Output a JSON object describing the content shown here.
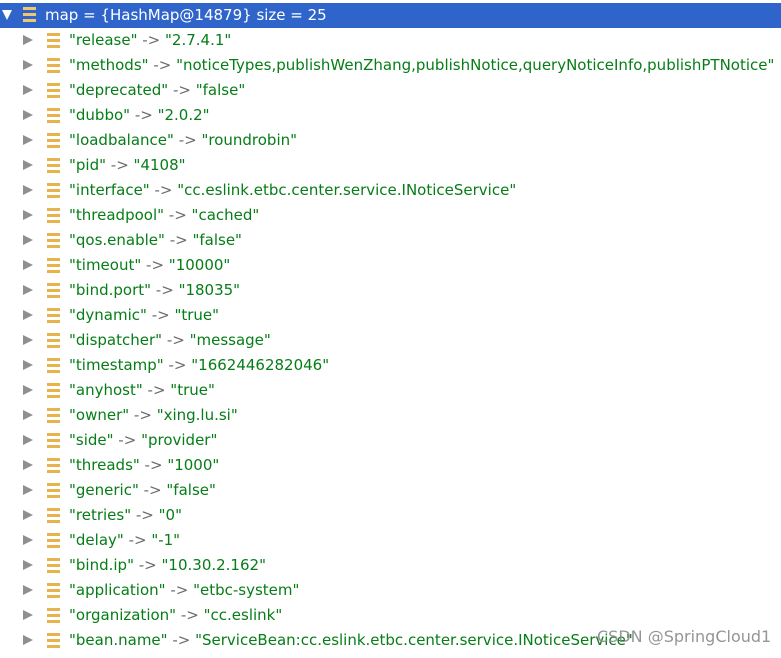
{
  "root": {
    "label": "map = {HashMap@14879}  size = 25"
  },
  "separator": " -> ",
  "entries": [
    {
      "key": "\"release\"",
      "value": "\"2.7.4.1\""
    },
    {
      "key": "\"methods\"",
      "value": "\"noticeTypes,publishWenZhang,publishNotice,queryNoticeInfo,publishPTNotice\""
    },
    {
      "key": "\"deprecated\"",
      "value": "\"false\""
    },
    {
      "key": "\"dubbo\"",
      "value": "\"2.0.2\""
    },
    {
      "key": "\"loadbalance\"",
      "value": "\"roundrobin\""
    },
    {
      "key": "\"pid\"",
      "value": "\"4108\""
    },
    {
      "key": "\"interface\"",
      "value": "\"cc.eslink.etbc.center.service.INoticeService\""
    },
    {
      "key": "\"threadpool\"",
      "value": "\"cached\""
    },
    {
      "key": "\"qos.enable\"",
      "value": "\"false\""
    },
    {
      "key": "\"timeout\"",
      "value": "\"10000\""
    },
    {
      "key": "\"bind.port\"",
      "value": "\"18035\""
    },
    {
      "key": "\"dynamic\"",
      "value": "\"true\""
    },
    {
      "key": "\"dispatcher\"",
      "value": "\"message\""
    },
    {
      "key": "\"timestamp\"",
      "value": "\"1662446282046\""
    },
    {
      "key": "\"anyhost\"",
      "value": "\"true\""
    },
    {
      "key": "\"owner\"",
      "value": "\"xing.lu.si\""
    },
    {
      "key": "\"side\"",
      "value": "\"provider\""
    },
    {
      "key": "\"threads\"",
      "value": "\"1000\""
    },
    {
      "key": "\"generic\"",
      "value": "\"false\""
    },
    {
      "key": "\"retries\"",
      "value": "\"0\""
    },
    {
      "key": "\"delay\"",
      "value": "\"-1\""
    },
    {
      "key": "\"bind.ip\"",
      "value": "\"10.30.2.162\""
    },
    {
      "key": "\"application\"",
      "value": "\"etbc-system\""
    },
    {
      "key": "\"organization\"",
      "value": "\"cc.eslink\""
    },
    {
      "key": "\"bean.name\"",
      "value": "\"ServiceBean:cc.eslink.etbc.center.service.INoticeService\""
    }
  ],
  "watermark": "CSDN @SpringCloud1",
  "colors": {
    "selection": "#2f65ca",
    "string_value": "#067d17",
    "field_icon": "#e8b24c"
  },
  "icons": {
    "expanded": "triangle-down-icon",
    "collapsed": "triangle-right-icon",
    "field": "field-icon"
  }
}
